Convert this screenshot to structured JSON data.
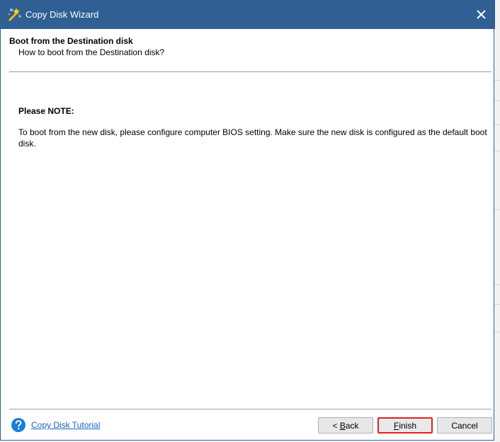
{
  "window": {
    "title": "Copy Disk Wizard",
    "titlebar_color": "#2f5f93",
    "close_icon": "close-icon"
  },
  "header": {
    "title": "Boot from the Destination disk",
    "subtitle": "How to boot from the Destination disk?"
  },
  "note": {
    "title": "Please NOTE:",
    "body": "To boot from the new disk, please configure computer BIOS setting. Make sure the new disk is configured as the default boot disk."
  },
  "footer": {
    "help_icon": "question-circle-icon",
    "tutorial_link": "Copy Disk Tutorial",
    "back_prefix": "< ",
    "back_access": "B",
    "back_rest": "ack",
    "finish_access": "F",
    "finish_rest": "inish",
    "cancel_label": "Cancel",
    "highlight_color": "#e0201f",
    "link_color": "#1a66c7"
  }
}
